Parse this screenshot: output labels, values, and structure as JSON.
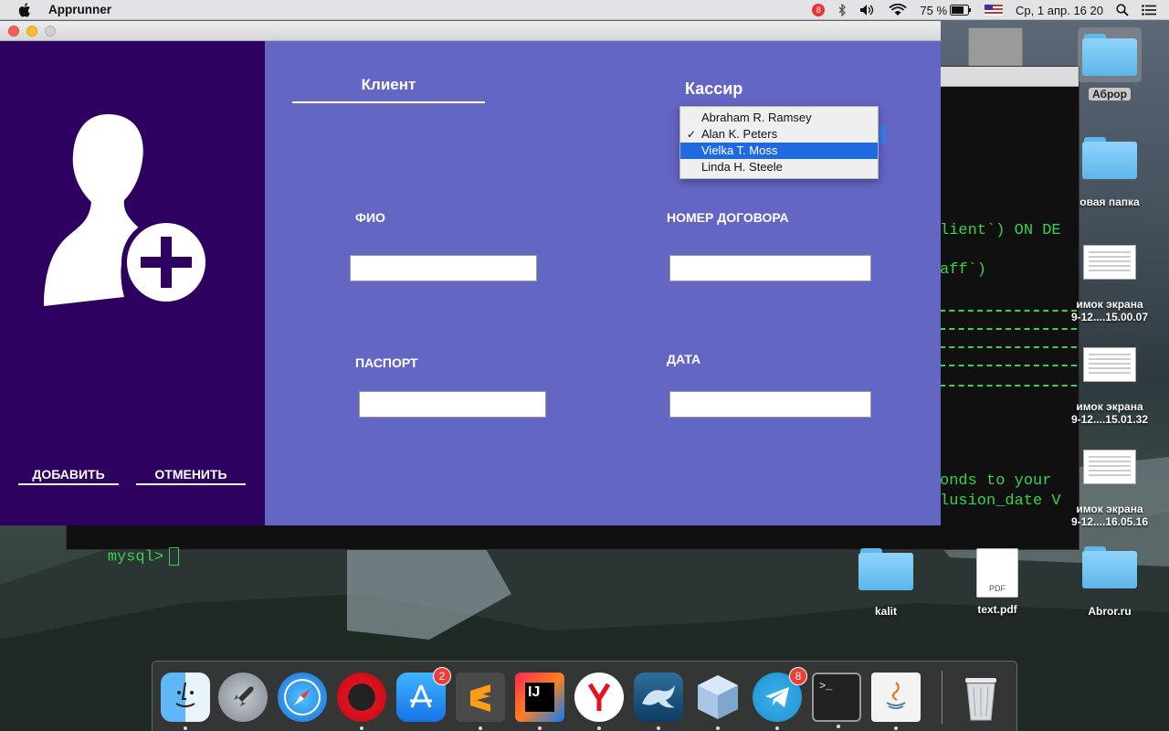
{
  "menubar": {
    "app_name": "Apprunner",
    "notification_count": "8",
    "battery": "75 %",
    "datetime": "Ср, 1 апр.  16 20"
  },
  "terminal": {
    "lines": [
      "lient`) ON DE",
      "aff`)",
      "onds to your",
      "lusion_date V"
    ],
    "prompt": "mysql>"
  },
  "desktop_icons": [
    {
      "label": "Аброр"
    },
    {
      "label": "овая папка"
    },
    {
      "label": "имок экрана\n9-12....15.00.07"
    },
    {
      "label": "имок экрана\n9-12....15.01.32"
    },
    {
      "label": "имок экрана\n9-12....16.05.16"
    },
    {
      "label": "kalit"
    },
    {
      "label": "text.pdf",
      "file_tag": "PDF"
    },
    {
      "label": "Abror.ru"
    }
  ],
  "app": {
    "sidebar": {
      "add_button": "ДОБАВИТЬ",
      "cancel_button": "ОТМЕНИТЬ"
    },
    "tab_client": "Клиент",
    "cashier_label": "Кассир",
    "fields": {
      "fio_label": "ФИО",
      "fio_value": "",
      "contract_label": "НОМЕР ДОГОВОРА",
      "contract_value": "",
      "passport_label": "ПАСПОРТ",
      "passport_value": "",
      "date_label": "ДАТА",
      "date_value": ""
    },
    "cashier_dropdown": {
      "options": [
        "Abraham R. Ramsey",
        "Alan K. Peters",
        "Vielka T. Moss",
        "Linda H. Steele"
      ],
      "selected": "Alan K. Peters",
      "highlighted": "Vielka T. Moss"
    }
  },
  "dock": {
    "apps": [
      {
        "name": "finder-icon"
      },
      {
        "name": "launchpad-icon"
      },
      {
        "name": "safari-icon"
      },
      {
        "name": "opera-icon"
      },
      {
        "name": "app-store-icon",
        "badge": "2"
      },
      {
        "name": "sublime-text-icon"
      },
      {
        "name": "intellij-idea-icon"
      },
      {
        "name": "yandex-browser-icon"
      },
      {
        "name": "mysql-workbench-icon"
      },
      {
        "name": "virtualbox-icon"
      },
      {
        "name": "telegram-icon",
        "badge": "8"
      },
      {
        "name": "terminal-icon",
        "text": ">_"
      },
      {
        "name": "java-icon"
      },
      {
        "name": "trash-icon"
      }
    ]
  },
  "colors": {
    "sidebar": "#2e0060",
    "main_panel": "#6466c4",
    "dropdown_highlight": "#1f6ae0",
    "terminal_text": "#39d24f"
  }
}
